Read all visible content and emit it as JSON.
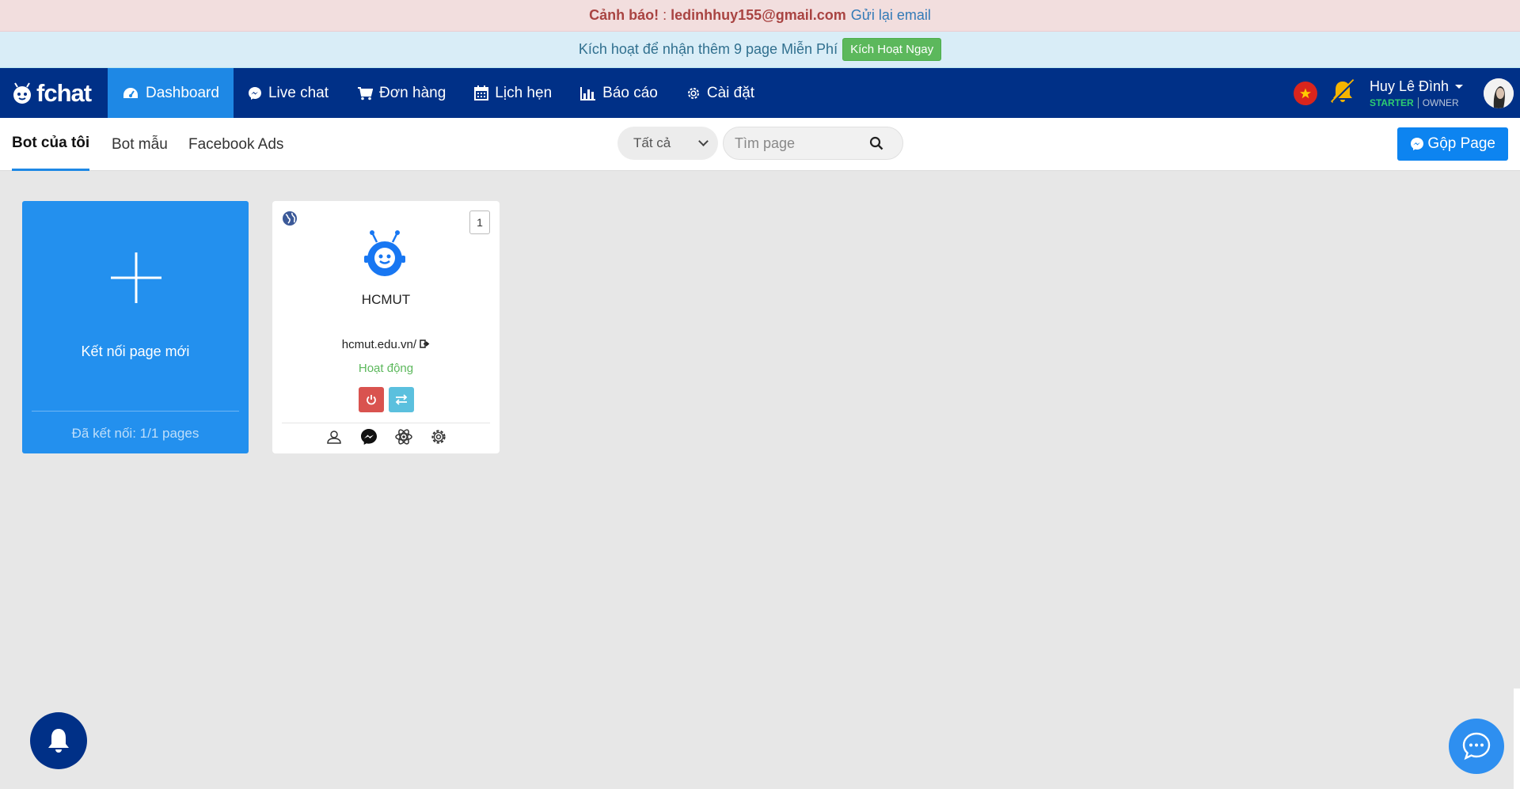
{
  "alerts": {
    "warning_prefix": "Cảnh báo!",
    "warning_sep": " : ",
    "warning_email": "ledinhhuy155@gmail.com",
    "warning_link": "Gửi lại email",
    "activate_text": "Kích hoạt để nhận thêm 9 page Miễn Phí",
    "activate_button": "Kích Hoạt Ngay"
  },
  "navbar": {
    "brand": "fchat",
    "items": [
      {
        "label": "Dashboard",
        "icon": "dashboard-icon",
        "active": true
      },
      {
        "label": "Live chat",
        "icon": "messenger-icon"
      },
      {
        "label": "Đơn hàng",
        "icon": "cart-icon"
      },
      {
        "label": "Lịch hẹn",
        "icon": "calendar-icon"
      },
      {
        "label": "Báo cáo",
        "icon": "bar-chart-icon"
      },
      {
        "label": "Cài đặt",
        "icon": "gear-icon"
      }
    ],
    "user": {
      "name": "Huy Lê Đình",
      "plan": "STARTER",
      "role": "OWNER"
    }
  },
  "toolbar": {
    "tabs": [
      {
        "label": "Bot của tôi",
        "active": true
      },
      {
        "label": "Bot mẫu"
      },
      {
        "label": "Facebook Ads"
      }
    ],
    "filter_value": "Tất cả",
    "search_placeholder": "Tìm page",
    "merge_button": "Gộp Page"
  },
  "cards": {
    "new_card": {
      "label": "Kết nối page mới",
      "footer": "Đã kết nối: 1/1 pages"
    },
    "pages": [
      {
        "name": "HCMUT",
        "url": "hcmut.edu.vn/",
        "status": "Hoạt động",
        "badge": "1"
      }
    ]
  },
  "colors": {
    "navbar": "#003087",
    "accent": "#1e88e5",
    "success": "#5cb85c",
    "danger": "#d9534f",
    "info": "#5bc0de"
  }
}
